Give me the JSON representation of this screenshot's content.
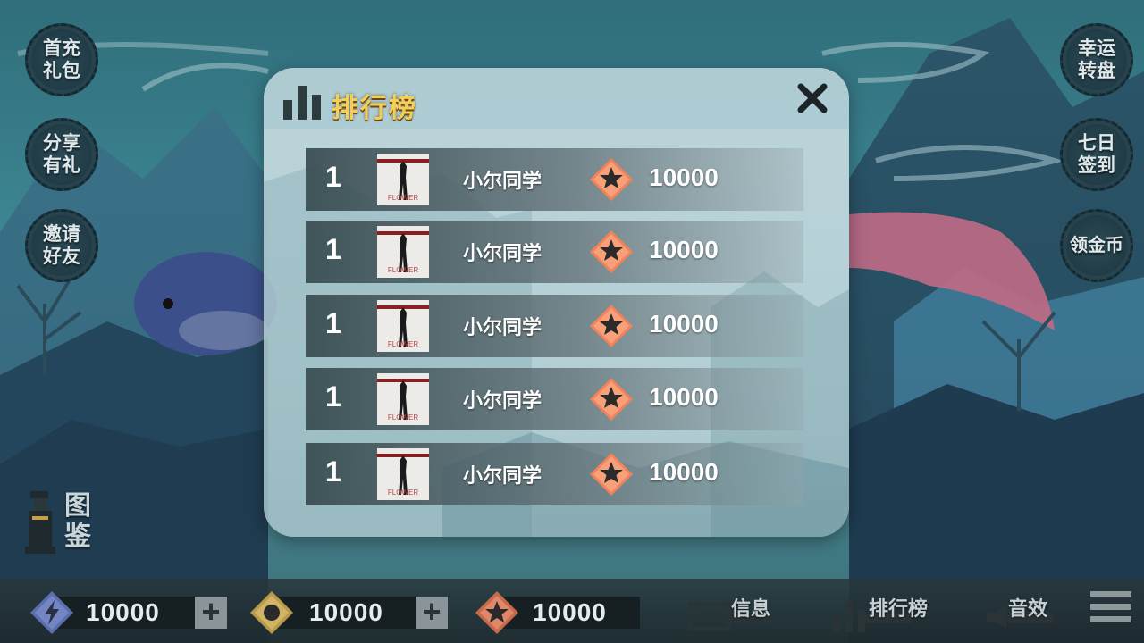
{
  "side_buttons_left": [
    {
      "label": "首充礼包"
    },
    {
      "label": "分享有礼"
    },
    {
      "label": "邀请好友"
    }
  ],
  "side_buttons_right": [
    {
      "label": "幸运转盘"
    },
    {
      "label": "七日签到"
    },
    {
      "label": "领金币"
    }
  ],
  "atlas": {
    "label": "图鉴"
  },
  "leaderboard": {
    "title": "排行榜",
    "rows": [
      {
        "rank": "1",
        "avatar_caption": "FLOWER",
        "name": "小尔同学",
        "score": "10000"
      },
      {
        "rank": "1",
        "avatar_caption": "FLOWER",
        "name": "小尔同学",
        "score": "10000"
      },
      {
        "rank": "1",
        "avatar_caption": "FLOWER",
        "name": "小尔同学",
        "score": "10000"
      },
      {
        "rank": "1",
        "avatar_caption": "FLOWER",
        "name": "小尔同学",
        "score": "10000"
      },
      {
        "rank": "1",
        "avatar_caption": "FLOWER",
        "name": "小尔同学",
        "score": "10000"
      }
    ]
  },
  "resources": {
    "energy": {
      "value": "10000",
      "icon": "lightning-icon"
    },
    "coins": {
      "value": "10000",
      "icon": "coin-icon"
    },
    "stars": {
      "value": "10000",
      "icon": "star-icon"
    }
  },
  "menu": {
    "messages": "信息",
    "leaderboard": "排行榜",
    "sound": "音效"
  },
  "colors": {
    "title_gold": "#f3cf5a",
    "star_orange": "#f0835a",
    "energy_blue": "#5a6fb0",
    "coin_gold": "#b79a4a"
  }
}
